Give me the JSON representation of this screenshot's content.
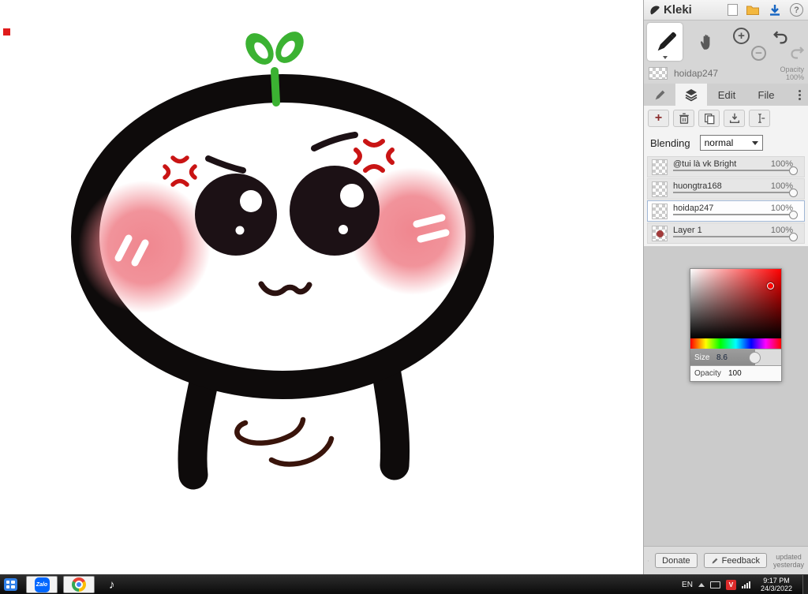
{
  "app": {
    "brand": "Kleki"
  },
  "topbar": {
    "help_glyph": "?"
  },
  "toolbar": {
    "zoom_in_glyph": "+",
    "zoom_out_glyph": "−",
    "project_name": "hoidap247",
    "opacity_label": "Opacity",
    "opacity_value": "100%"
  },
  "tabs": {
    "edit": "Edit",
    "file": "File"
  },
  "layers_panel": {
    "add_glyph": "+",
    "blending_label": "Blending",
    "blending_value": "normal",
    "layers": [
      {
        "name": "@tui là vk Bright",
        "opacity": "100%"
      },
      {
        "name": "huongtra168",
        "opacity": "100%"
      },
      {
        "name": "hoidap247",
        "opacity": "100%"
      },
      {
        "name": "Layer 1",
        "opacity": "100%"
      }
    ]
  },
  "color_picker": {
    "selected_color": "#ff0000",
    "size_label": "Size",
    "size_value": "8.6",
    "opacity_label": "Opacity",
    "opacity_value": "100"
  },
  "footer": {
    "donate_label": "Donate",
    "feedback_label": "Feedback",
    "updated_line1": "updated",
    "updated_line2": "yesterday"
  },
  "taskbar": {
    "language": "EN",
    "unikey_label": "V",
    "tiktok_glyph": "♪",
    "zalo_label": "Zalo",
    "time": "9:17 PM",
    "date": "24/3/2022"
  }
}
